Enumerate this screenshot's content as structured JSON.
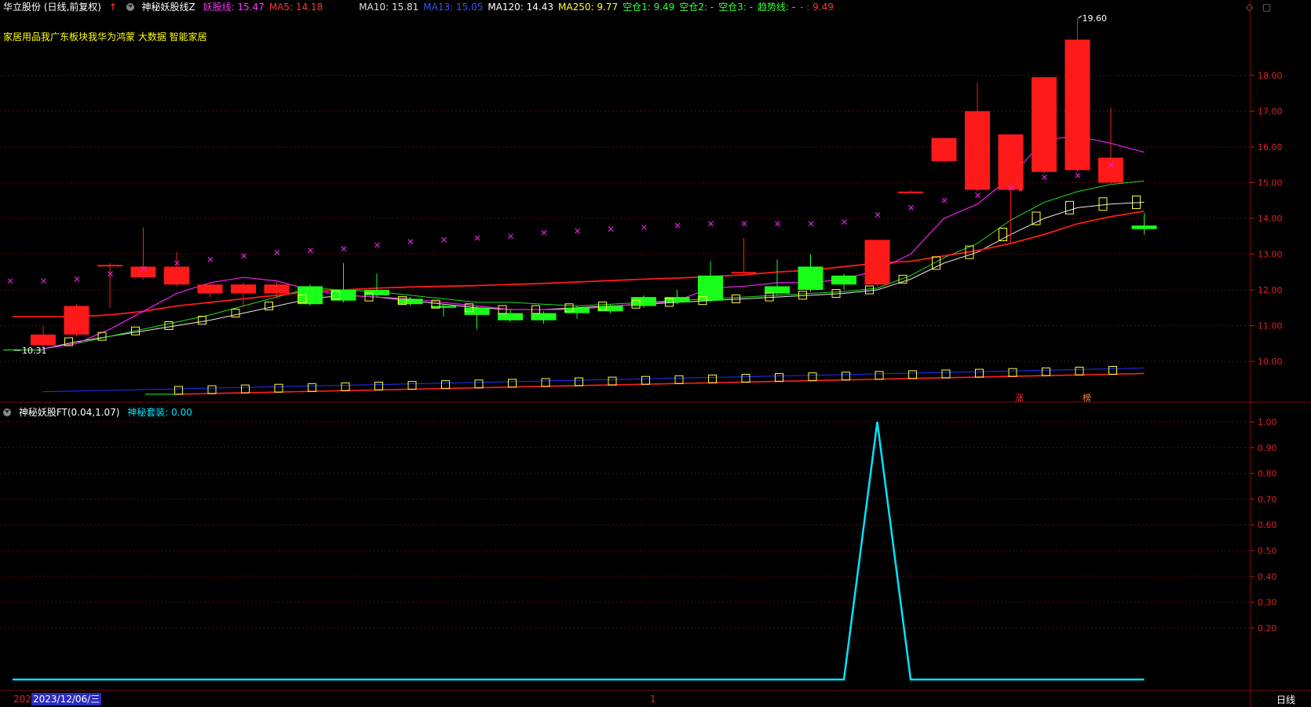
{
  "header": {
    "stock_title": "华立股份 (日线,前复权)",
    "indicator_name": "神秘妖股线Z",
    "items": [
      {
        "label": "妖股线: 15.47",
        "color": "#ff33ff"
      },
      {
        "label": "MA5: 14.18",
        "color": "#ff3333"
      },
      {
        "label": "MA10: 15.81",
        "color": "#e0e0e0"
      },
      {
        "label": "MA13: 15.05",
        "color": "#3355ff"
      },
      {
        "label": "MA120: 14.43",
        "color": "#ffffff"
      },
      {
        "label": "MA250: 9.77",
        "color": "#ffff33"
      },
      {
        "label": "空仓1: 9.49",
        "color": "#33ff33"
      },
      {
        "label": "空仓2: -",
        "color": "#33ff33"
      },
      {
        "label": "空仓3: -",
        "color": "#33ff33"
      },
      {
        "label": "趋势线: -",
        "color": "#33ff33"
      },
      {
        "label": "- : 9.49",
        "color": "#ff3333"
      }
    ]
  },
  "concepts": "家居用品我广东板块我华为鸿蒙 大数据 智能家居",
  "controls": {
    "diamond": "◇",
    "restore": "▢"
  },
  "sub_header": {
    "indicator": "神秘妖股FT(0.04,1.07)",
    "value": "神秘套装: 0.00",
    "value_color": "#00e5ff"
  },
  "price_axis": {
    "ticks": [
      "18.00",
      "17.00",
      "16.00",
      "15.00",
      "14.00",
      "13.00",
      "12.00",
      "11.00",
      "10.00"
    ],
    "values": [
      18,
      17,
      16,
      15,
      14,
      13,
      12,
      11,
      10
    ]
  },
  "sub_axis": {
    "ticks": [
      "1.00",
      "0.90",
      "0.80",
      "0.70",
      "0.60",
      "0.50",
      "0.40",
      "0.30",
      "0.20"
    ],
    "values": [
      1,
      0.9,
      0.8,
      0.7,
      0.6,
      0.5,
      0.4,
      0.3,
      0.2
    ]
  },
  "annotations": {
    "high": "19.60",
    "low": "10.31",
    "tag_zhang": "涨",
    "tag_bang": "榜"
  },
  "footer": {
    "date_prefix": "202",
    "date": "2023/12/06/三",
    "cursor": "1",
    "period": "日线"
  },
  "chart_data": {
    "type": "candlestick",
    "colors": {
      "up": "#ff1a1a",
      "down": "#1aff1a"
    },
    "candles": [
      {
        "o": 10.45,
        "c": 10.75,
        "h": 11.0,
        "l": 10.4
      },
      {
        "o": 10.75,
        "c": 11.55,
        "h": 11.6,
        "l": 10.7
      },
      {
        "o": 12.7,
        "c": 12.7,
        "h": 12.75,
        "l": 11.5
      },
      {
        "o": 12.35,
        "c": 12.65,
        "h": 13.75,
        "l": 12.3
      },
      {
        "o": 12.15,
        "c": 12.65,
        "h": 13.05,
        "l": 12.1
      },
      {
        "o": 11.9,
        "c": 12.15,
        "h": 12.2,
        "l": 11.8
      },
      {
        "o": 11.9,
        "c": 12.15,
        "h": 12.2,
        "l": 11.5
      },
      {
        "o": 11.9,
        "c": 12.15,
        "h": 12.25,
        "l": 11.75
      },
      {
        "o": 12.1,
        "c": 11.6,
        "h": 12.15,
        "l": 11.55
      },
      {
        "o": 12.0,
        "c": 11.7,
        "h": 12.75,
        "l": 11.65
      },
      {
        "o": 12.0,
        "c": 11.85,
        "h": 12.45,
        "l": 11.8
      },
      {
        "o": 11.75,
        "c": 11.6,
        "h": 11.8,
        "l": 11.55
      },
      {
        "o": 11.55,
        "c": 11.5,
        "h": 11.6,
        "l": 11.25
      },
      {
        "o": 11.5,
        "c": 11.3,
        "h": 11.55,
        "l": 10.9
      },
      {
        "o": 11.35,
        "c": 11.15,
        "h": 11.45,
        "l": 11.1
      },
      {
        "o": 11.35,
        "c": 11.15,
        "h": 11.4,
        "l": 11.05
      },
      {
        "o": 11.5,
        "c": 11.35,
        "h": 11.55,
        "l": 11.2
      },
      {
        "o": 11.55,
        "c": 11.4,
        "h": 11.6,
        "l": 11.35
      },
      {
        "o": 11.8,
        "c": 11.55,
        "h": 11.85,
        "l": 11.5
      },
      {
        "o": 11.8,
        "c": 11.65,
        "h": 12.0,
        "l": 11.6
      },
      {
        "o": 12.4,
        "c": 11.7,
        "h": 12.8,
        "l": 11.65
      },
      {
        "o": 12.5,
        "c": 12.5,
        "h": 13.45,
        "l": 12.45
      },
      {
        "o": 12.1,
        "c": 11.9,
        "h": 12.85,
        "l": 11.85
      },
      {
        "o": 12.65,
        "c": 12.0,
        "h": 13.0,
        "l": 11.95
      },
      {
        "o": 12.4,
        "c": 12.15,
        "h": 12.45,
        "l": 12.0
      },
      {
        "o": 12.15,
        "c": 13.4,
        "h": 13.4,
        "l": 12.1
      },
      {
        "o": 14.75,
        "c": 14.75,
        "h": 14.8,
        "l": 14.7
      },
      {
        "o": 15.6,
        "c": 16.25,
        "h": 16.25,
        "l": 15.55
      },
      {
        "o": 14.8,
        "c": 17.0,
        "h": 17.8,
        "l": 14.75
      },
      {
        "o": 14.8,
        "c": 16.35,
        "h": 16.35,
        "l": 13.3
      },
      {
        "o": 15.3,
        "c": 17.95,
        "h": 17.95,
        "l": 15.25
      },
      {
        "o": 15.35,
        "c": 19.0,
        "h": 19.6,
        "l": 15.3
      },
      {
        "o": 15.0,
        "c": 15.7,
        "h": 17.1,
        "l": 14.95
      },
      {
        "o": 13.8,
        "c": 13.7,
        "h": 14.15,
        "l": 13.55
      }
    ],
    "ma_red": [
      11.25,
      11.25,
      11.3,
      11.4,
      11.55,
      11.65,
      11.75,
      11.85,
      11.95,
      12.0,
      12.05,
      12.08,
      12.1,
      12.12,
      12.15,
      12.18,
      12.22,
      12.26,
      12.3,
      12.33,
      12.37,
      12.42,
      12.5,
      12.55,
      12.65,
      12.75,
      12.8,
      12.95,
      13.1,
      13.3,
      13.55,
      13.85,
      14.05,
      14.2
    ],
    "ma_magenta": [
      10.35,
      10.5,
      10.9,
      11.4,
      11.9,
      12.2,
      12.35,
      12.25,
      12.0,
      11.85,
      11.8,
      11.75,
      11.65,
      11.55,
      11.45,
      11.45,
      11.45,
      11.55,
      11.6,
      11.7,
      12.05,
      12.1,
      12.2,
      12.2,
      12.3,
      12.55,
      13.0,
      14.0,
      14.4,
      15.15,
      16.2,
      16.3,
      16.1,
      15.85
    ],
    "ma_green": [
      10.35,
      10.5,
      10.7,
      10.9,
      11.1,
      11.3,
      11.55,
      11.8,
      12.05,
      12.0,
      11.95,
      11.85,
      11.75,
      11.65,
      11.65,
      11.6,
      11.55,
      11.6,
      11.65,
      11.7,
      11.75,
      11.8,
      11.85,
      11.9,
      11.95,
      12.05,
      12.4,
      12.9,
      13.3,
      13.95,
      14.45,
      14.75,
      14.95,
      15.05
    ],
    "ma_white": [
      10.35,
      10.55,
      10.7,
      10.85,
      11.0,
      11.15,
      11.35,
      11.55,
      11.75,
      11.85,
      11.8,
      11.7,
      11.6,
      11.5,
      11.45,
      11.45,
      11.5,
      11.55,
      11.6,
      11.65,
      11.7,
      11.75,
      11.8,
      11.85,
      11.9,
      12.0,
      12.3,
      12.75,
      13.05,
      13.55,
      14.0,
      14.3,
      14.4,
      14.45
    ],
    "cross_markers": [
      12.25,
      12.25,
      12.3,
      12.45,
      12.6,
      12.75,
      12.85,
      12.95,
      13.05,
      13.1,
      13.15,
      13.25,
      13.35,
      13.4,
      13.45,
      13.5,
      13.6,
      13.65,
      13.7,
      13.75,
      13.8,
      13.85,
      13.85,
      13.85,
      13.85,
      13.9,
      14.1,
      14.3,
      14.5,
      14.65,
      14.85,
      15.15,
      15.2,
      15.5
    ],
    "ma_blue": [
      9.15,
      9.17,
      9.19,
      9.21,
      9.23,
      9.25,
      9.27,
      9.29,
      9.31,
      9.33,
      9.35,
      9.37,
      9.39,
      9.41,
      9.43,
      9.45,
      9.47,
      9.49,
      9.51,
      9.53,
      9.55,
      9.57,
      9.59,
      9.61,
      9.63,
      9.65,
      9.67,
      9.69,
      9.71,
      9.73,
      9.75,
      9.77,
      9.79,
      9.81
    ],
    "ma_floor": [
      null,
      null,
      null,
      null,
      9.08,
      9.1,
      9.12,
      9.14,
      9.16,
      9.18,
      9.2,
      9.22,
      9.24,
      9.26,
      9.28,
      9.3,
      9.32,
      9.34,
      9.36,
      9.38,
      9.4,
      9.42,
      9.44,
      9.46,
      9.48,
      9.5,
      9.52,
      9.54,
      9.56,
      9.58,
      9.6,
      9.62,
      9.64,
      9.66
    ],
    "floor_boxes": [
      null,
      null,
      null,
      null,
      null,
      9.1,
      9.12,
      9.14,
      9.16,
      9.18,
      9.2,
      9.22,
      9.24,
      9.26,
      9.28,
      9.3,
      9.32,
      9.34,
      9.36,
      9.38,
      9.4,
      9.42,
      9.44,
      9.46,
      9.48,
      9.5,
      9.52,
      9.54,
      9.56,
      9.58,
      9.6,
      9.62,
      9.64,
      9.66
    ],
    "sub_series": [
      0,
      0,
      0,
      0,
      0,
      0,
      0,
      0,
      0,
      0,
      0,
      0,
      0,
      0,
      0,
      0,
      0,
      0,
      0,
      0,
      0,
      0,
      0,
      0,
      0,
      1,
      0,
      0,
      0,
      0,
      0,
      0,
      0,
      0
    ]
  }
}
